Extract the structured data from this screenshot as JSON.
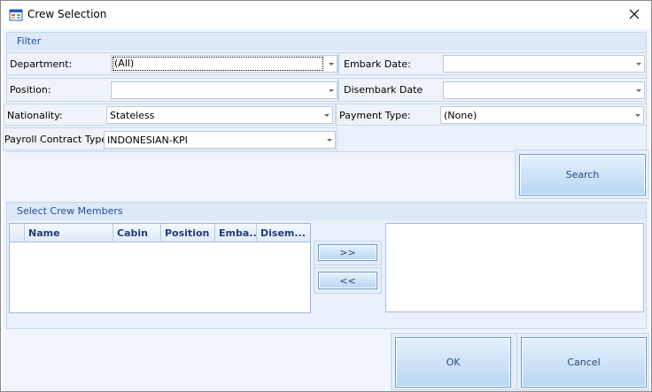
{
  "window": {
    "title": "Crew Selection"
  },
  "filter": {
    "header": "Filter",
    "department": {
      "label": "Department:",
      "value": "(All)"
    },
    "embark_date": {
      "label": "Embark Date:",
      "value": ""
    },
    "position": {
      "label": "Position:",
      "value": ""
    },
    "disembark_date": {
      "label": "Disembark Date",
      "value": ""
    },
    "nationality": {
      "label": "Nationality:",
      "value": "Stateless"
    },
    "payment_type": {
      "label": "Payment Type:",
      "value": "(None)"
    },
    "payroll_contract_type": {
      "label": "Payroll Contract Type:",
      "value": "INDONESIAN-KPI"
    }
  },
  "search_button": "Search",
  "crew": {
    "header": "Select Crew Members",
    "columns": [
      "Name",
      "Cabin",
      "Position",
      "Emba...",
      "Disem..."
    ],
    "add_button": ">>",
    "remove_button": "<<"
  },
  "ok_button": "OK",
  "cancel_button": "Cancel",
  "colors": {
    "accent": "#1f4e9e",
    "button_border": "#6b99cf",
    "panel": "#eaf1fa"
  }
}
